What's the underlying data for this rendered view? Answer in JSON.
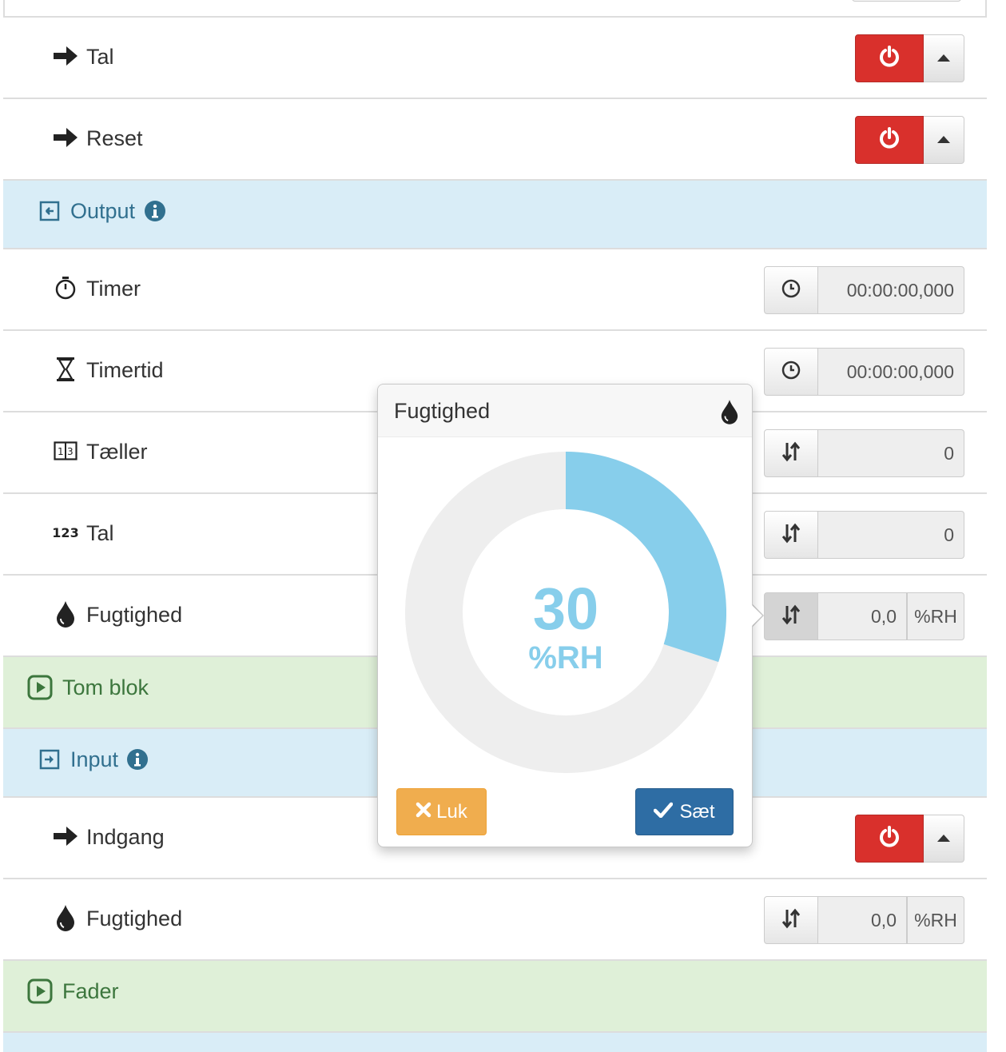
{
  "rows": {
    "tal_toggle": {
      "label": "Tal"
    },
    "reset_toggle": {
      "label": "Reset"
    },
    "output_header": {
      "label": "Output"
    },
    "timer": {
      "label": "Timer",
      "value": "00:00:00,000"
    },
    "timertid": {
      "label": "Timertid",
      "value": "00:00:00,000"
    },
    "taeller": {
      "label": "Tæller",
      "value": "0"
    },
    "tal_number": {
      "label": "Tal",
      "icon_text": "123",
      "value": "0"
    },
    "fugtighed_output": {
      "label": "Fugtighed",
      "value": "0,0",
      "unit": "%RH"
    },
    "tom_blok": {
      "label": "Tom blok"
    },
    "input_header": {
      "label": "Input"
    },
    "indgang": {
      "label": "Indgang"
    },
    "fugtighed_input": {
      "label": "Fugtighed",
      "value": "0,0",
      "unit": "%RH"
    },
    "fader": {
      "label": "Fader"
    }
  },
  "popover": {
    "title": "Fugtighed",
    "gauge_value": "30",
    "gauge_unit": "%RH",
    "gauge_fraction": 0.3,
    "close_label": "Luk",
    "set_label": "Sæt"
  },
  "colors": {
    "danger": "#d9302c",
    "info_bg": "#d9edf7",
    "info_text": "#31708f",
    "success_bg": "#dff0d8",
    "success_text": "#3c763d",
    "gauge_fill": "#87ceeb",
    "gauge_track": "#eeeeee",
    "warning": "#f0ad4e",
    "primary": "#2e6da4"
  },
  "icons": [
    "arrow-right-icon",
    "power-icon",
    "caret-up-icon",
    "log-in-icon",
    "info-sign-icon",
    "stopwatch-icon",
    "hourglass-icon",
    "counter-icon",
    "number-icon",
    "tint-icon",
    "clock-icon",
    "sort-icon",
    "play-square-icon",
    "remove-icon",
    "ok-icon"
  ]
}
